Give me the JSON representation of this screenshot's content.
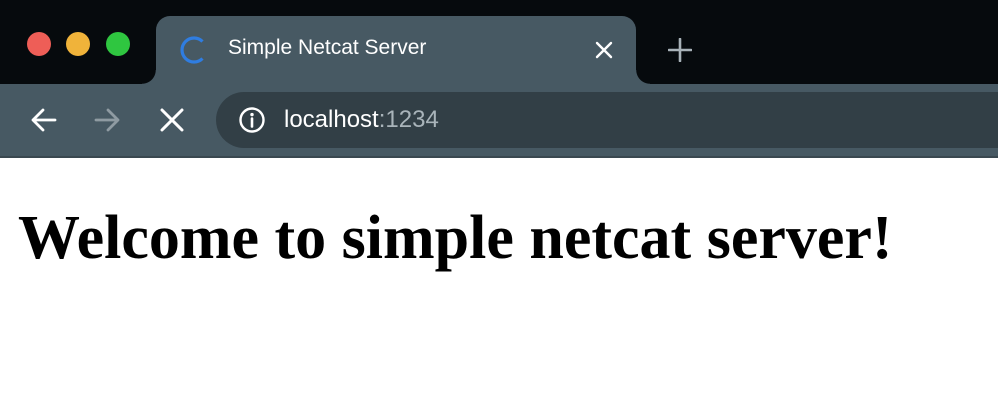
{
  "window": {
    "buttons": [
      "close",
      "minimize",
      "zoom"
    ]
  },
  "tab": {
    "title": "Simple Netcat Server",
    "loading": true
  },
  "toolbar": {
    "url_host": "localhost",
    "url_port": ":1234"
  },
  "page": {
    "heading": "Welcome to simple netcat server!"
  },
  "colors": {
    "tabstrip_bg": "#060a0d",
    "active_tab_bg": "#475963",
    "omnibox_bg": "#323f46",
    "spinner": "#2f7de1",
    "close_light": "#ee5e57",
    "minimize_light": "#f0b33a",
    "zoom_light": "#2fc640"
  },
  "icons": {
    "back": "arrow-left-icon",
    "forward": "arrow-right-icon",
    "stop": "close-icon",
    "site_info": "info-circle-icon",
    "tab_spinner": "loading-spinner-icon",
    "tab_close": "close-icon",
    "new_tab": "plus-icon"
  }
}
